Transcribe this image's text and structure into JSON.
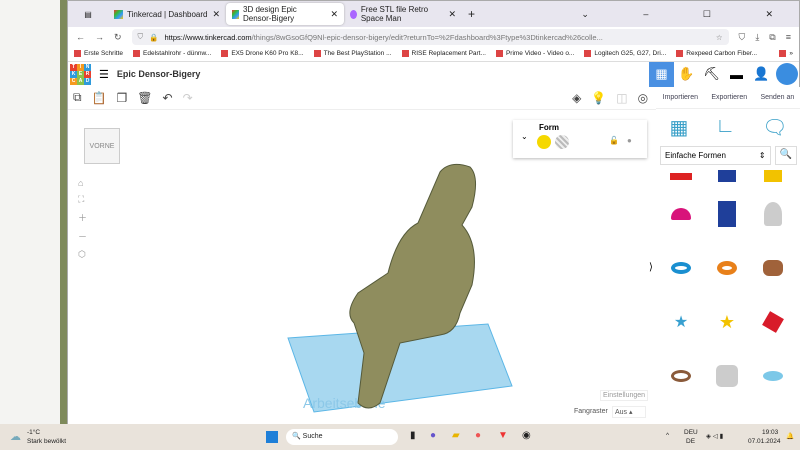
{
  "browser": {
    "tabs": [
      {
        "label": "Tinkercad | Dashboard",
        "active": false
      },
      {
        "label": "3D design Epic Densor-Bigery",
        "active": true
      },
      {
        "label": "Free STL file Retro Space Man",
        "active": false
      }
    ],
    "url_host": "https://www.tinkercad.com",
    "url_path": "/things/8wGsoGfQ9Nl-epic-densor-bigery/edit?returnTo=%2Fdashboard%3Ftype%3Dtinkercad%26colle...",
    "bookmarks": [
      "Erste Schritte",
      "Edelstahlrohr - dünnw...",
      "EX5 Drone K60 Pro K8...",
      "The Best PlayStation ...",
      "RISE Replacement Part...",
      "Prime Video - Video o...",
      "Logitech G25, G27, Dri...",
      "Rexpeed Carbon Fiber..."
    ]
  },
  "app": {
    "logo_letters": [
      "T",
      "I",
      "N",
      "K",
      "E",
      "R",
      "C",
      "A",
      "D"
    ],
    "design_title": "Epic Densor-Bigery",
    "accent": "#4a90e2"
  },
  "side": {
    "actions": [
      "Importieren",
      "Exportieren",
      "Senden an"
    ],
    "category": "Einfache Formen"
  },
  "form_panel": {
    "label": "Form",
    "solid_color": "#f5d800"
  },
  "viewcube": {
    "label": "VORNE"
  },
  "workplane": {
    "watermark": "Arbeitsebene"
  },
  "settings": {
    "label": "Einstellungen",
    "snap_label": "Fangraster",
    "snap_value": "Aus"
  },
  "taskbar": {
    "temp": "-1°C",
    "weather": "Stark bewölkt",
    "search": "Suche",
    "lang1": "DEU",
    "lang2": "DE",
    "time": "19:03",
    "date": "07.01.2024"
  }
}
